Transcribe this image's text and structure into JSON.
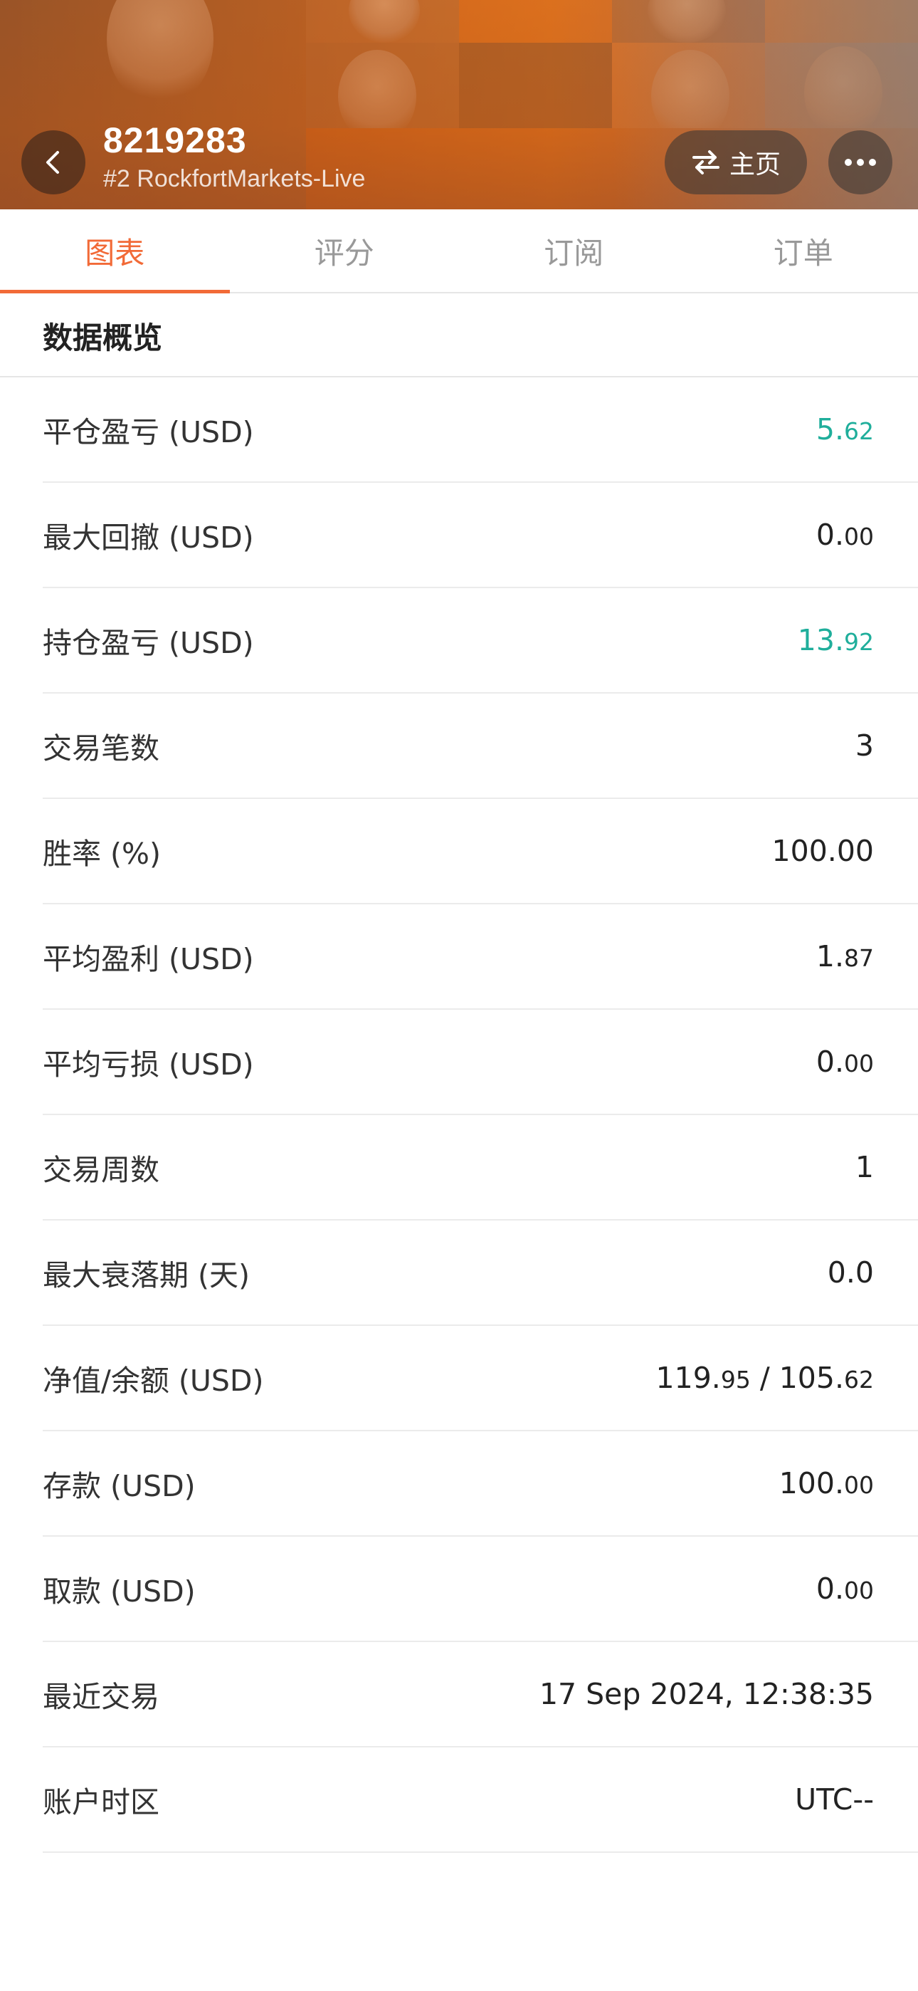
{
  "header": {
    "account_id": "8219283",
    "server": "#2 RockfortMarkets-Live",
    "home_label": "主页"
  },
  "tabs": [
    {
      "label": "图表",
      "active": true
    },
    {
      "label": "评分",
      "active": false
    },
    {
      "label": "订阅",
      "active": false
    },
    {
      "label": "订单",
      "active": false
    }
  ],
  "section_title": "数据概览",
  "colors": {
    "accent": "#f26a37",
    "positive": "#1fae9b"
  },
  "stats": [
    {
      "label": "平仓盈亏 (USD)",
      "value_main": "5.",
      "value_small": "62",
      "value_rest": "",
      "value_small2": "",
      "positive": true
    },
    {
      "label": "最大回撤 (USD)",
      "value_main": "0.",
      "value_small": "00",
      "value_rest": "",
      "value_small2": "",
      "positive": false
    },
    {
      "label": "持仓盈亏 (USD)",
      "value_main": "13.",
      "value_small": "92",
      "value_rest": "",
      "value_small2": "",
      "positive": true
    },
    {
      "label": "交易笔数",
      "value_main": "3",
      "value_small": "",
      "value_rest": "",
      "value_small2": "",
      "positive": false
    },
    {
      "label": "胜率 (%)",
      "value_main": "100.00",
      "value_small": "",
      "value_rest": "",
      "value_small2": "",
      "positive": false
    },
    {
      "label": "平均盈利 (USD)",
      "value_main": "1.",
      "value_small": "87",
      "value_rest": "",
      "value_small2": "",
      "positive": false
    },
    {
      "label": "平均亏损 (USD)",
      "value_main": "0.",
      "value_small": "00",
      "value_rest": "",
      "value_small2": "",
      "positive": false
    },
    {
      "label": "交易周数",
      "value_main": "1",
      "value_small": "",
      "value_rest": "",
      "value_small2": "",
      "positive": false
    },
    {
      "label": "最大衰落期 (天)",
      "value_main": "0.0",
      "value_small": "",
      "value_rest": "",
      "value_small2": "",
      "positive": false
    },
    {
      "label": "净值/余额 (USD)",
      "value_main": "119.",
      "value_small": "95",
      "value_rest": " / 105.",
      "value_small2": "62",
      "positive": false
    },
    {
      "label": "存款 (USD)",
      "value_main": "100.",
      "value_small": "00",
      "value_rest": "",
      "value_small2": "",
      "positive": false
    },
    {
      "label": "取款 (USD)",
      "value_main": "0.",
      "value_small": "00",
      "value_rest": "",
      "value_small2": "",
      "positive": false
    },
    {
      "label": "最近交易",
      "value_main": "17 Sep 2024, 12:38:35",
      "value_small": "",
      "value_rest": "",
      "value_small2": "",
      "positive": false
    },
    {
      "label": "账户时区",
      "value_main": "UTC--",
      "value_small": "",
      "value_rest": "",
      "value_small2": "",
      "positive": false
    }
  ]
}
